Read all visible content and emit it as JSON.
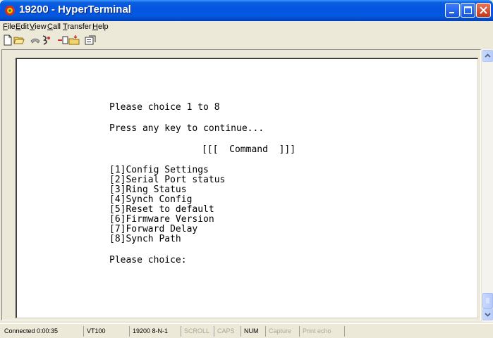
{
  "window": {
    "title": "19200 - HyperTerminal"
  },
  "menu": [
    {
      "label": "File"
    },
    {
      "label": "Edit"
    },
    {
      "label": "View"
    },
    {
      "label": "Call"
    },
    {
      "label": "Transfer"
    },
    {
      "label": "Help"
    }
  ],
  "toolbar_icons": [
    "new-icon",
    "open-icon",
    "connect-icon",
    "disconnect-icon",
    "send-icon",
    "receive-icon",
    "properties-icon"
  ],
  "terminal": {
    "prompt_range": "Please choice 1 to 8",
    "continue": "Press any key to continue...",
    "command_header": "[[[  Command  ]]]",
    "options": [
      "[1]Config Settings",
      "[2]Serial Port status",
      "[3]Ring Status",
      "[4]Synch Config",
      "[5]Reset to default",
      "[6]Firmware Version",
      "[7]Forward Delay",
      "[8]Synch Path"
    ],
    "choice_prompt": "Please choice:"
  },
  "status": {
    "connected": "Connected 0:00:35",
    "emulation": "VT100",
    "port_settings": "19200 8-N-1",
    "scroll": "SCROLL",
    "caps": "CAPS",
    "num": "NUM",
    "capture": "Capture",
    "print_echo": "Print echo"
  },
  "colors": {
    "title_bar": "#0554e3",
    "close_button": "#c4371c",
    "terminal_bg": "#ffffff",
    "chrome": "#ece9d8"
  }
}
